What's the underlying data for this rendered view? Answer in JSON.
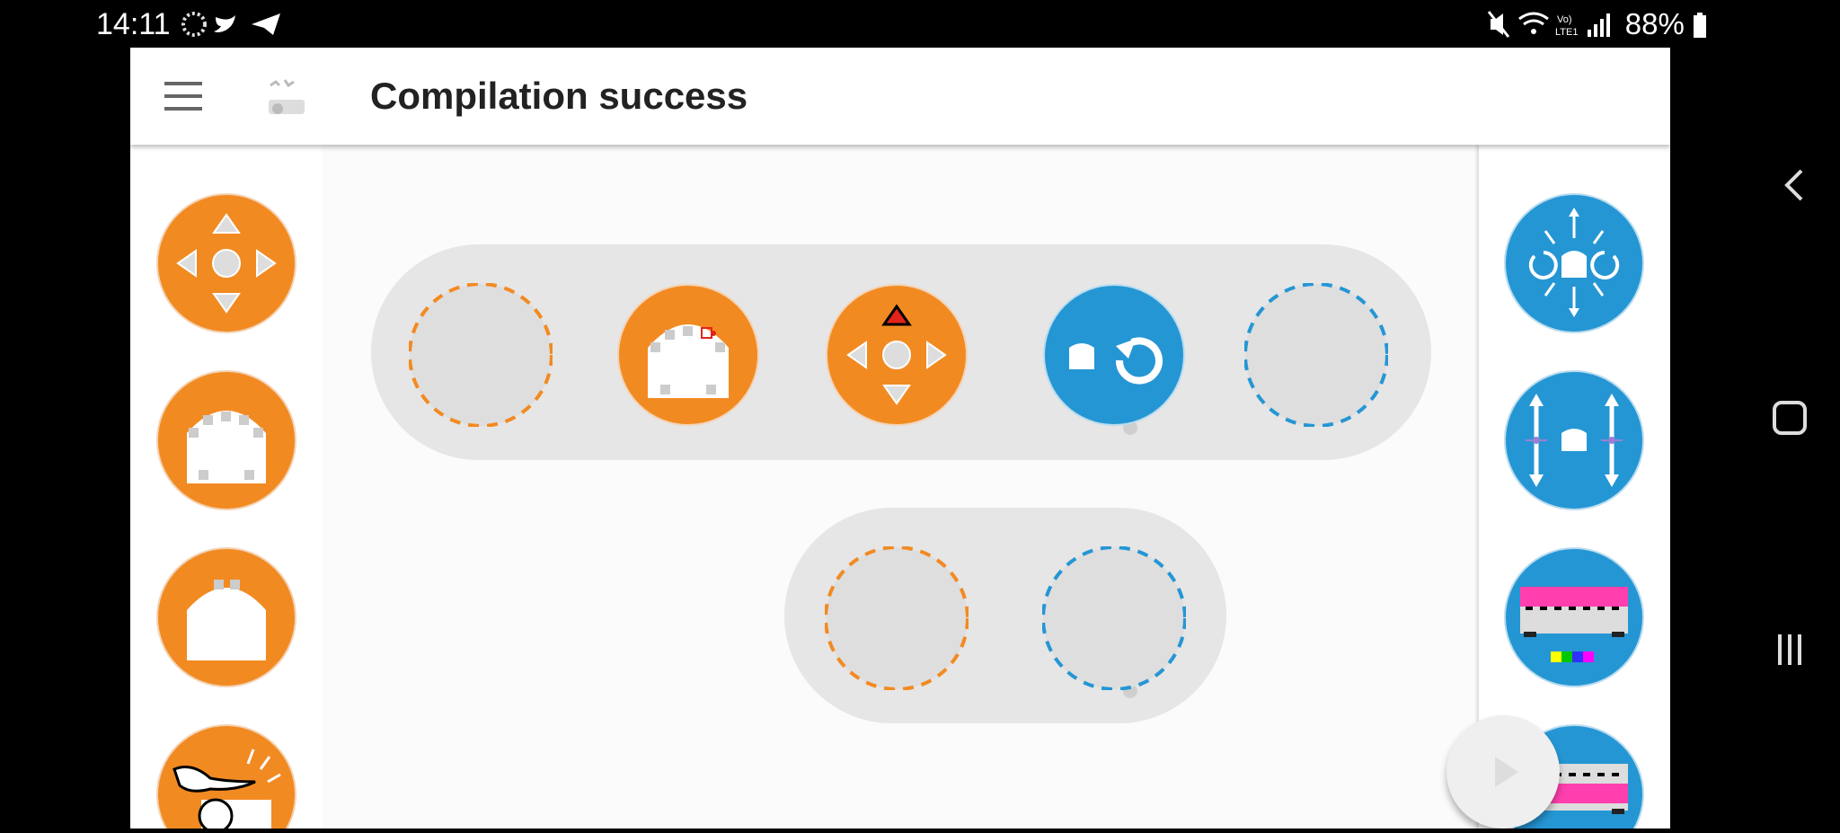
{
  "status_bar": {
    "time": "14:11",
    "battery": "88%",
    "left_icons": [
      "sync-icon",
      "twitter-icon",
      "telegram-icon"
    ],
    "right_icons": [
      "mute-icon",
      "wifi-icon",
      "volte-icon",
      "signal-icon",
      "battery-icon"
    ]
  },
  "toolbar": {
    "title": "Compilation success",
    "menu_icon": "hamburger-menu-icon",
    "app_icon": "robot-app-icon"
  },
  "colors": {
    "event_orange": "#f28a22",
    "action_blue": "#2596d4",
    "slot_gray": "#e0e0e0",
    "pill_gray": "#e6e6e6"
  },
  "left_palette": [
    {
      "name": "button-event-block",
      "icon": "arrow-buttons-icon"
    },
    {
      "name": "front-proximity-event-block",
      "icon": "front-sensors-icon"
    },
    {
      "name": "ground-sensor-event-block",
      "icon": "ground-sensors-icon"
    },
    {
      "name": "tap-event-block",
      "icon": "tap-hand-icon"
    }
  ],
  "right_palette": [
    {
      "name": "motion-action-block",
      "icon": "move-arrows-icon"
    },
    {
      "name": "motor-speed-action-block",
      "icon": "motor-sliders-icon"
    },
    {
      "name": "top-color-action-block",
      "icon": "top-color-icon"
    },
    {
      "name": "bottom-color-action-block",
      "icon": "bottom-color-icon"
    }
  ],
  "rows": [
    {
      "events": [
        "empty-event-slot",
        "front-proximity-event-block",
        "button-event-block"
      ],
      "action": [
        "rotate-action-block",
        "empty-action-slot"
      ]
    },
    {
      "events": [
        "empty-event-slot"
      ],
      "action": [
        "empty-action-slot"
      ]
    }
  ],
  "play_button": {
    "icon": "play-icon"
  },
  "nav_bar": {
    "icons": [
      "back-icon",
      "home-icon",
      "recents-icon"
    ]
  }
}
